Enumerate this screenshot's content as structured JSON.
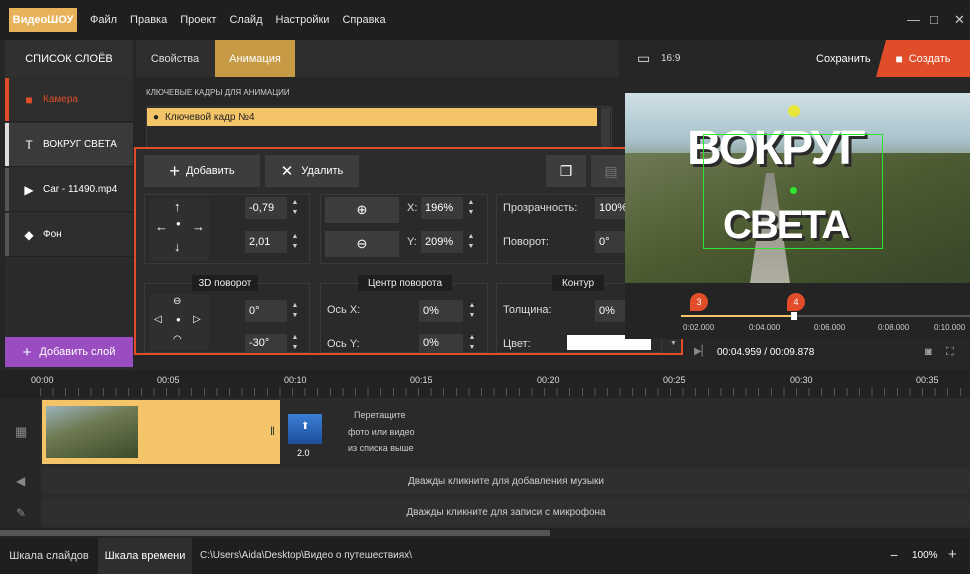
{
  "app": {
    "logo_a": "Видео",
    "logo_b": "ШОУ"
  },
  "menu": [
    "Файл",
    "Правка",
    "Проект",
    "Слайд",
    "Настройки",
    "Справка"
  ],
  "window": {
    "minimize": "—",
    "maximize": "□",
    "close": "✕"
  },
  "layers": {
    "title": "СПИСОК СЛОЁВ",
    "items": [
      {
        "label": "Камера",
        "icon": "camera-icon",
        "glyph": "■"
      },
      {
        "label": "ВОКРУГ  СВЕТА",
        "icon": "text-icon",
        "glyph": "T"
      },
      {
        "label": "Car - 11490.mp4",
        "icon": "video-icon",
        "glyph": "▶"
      },
      {
        "label": "Фон",
        "icon": "fill-icon",
        "glyph": "◆"
      }
    ],
    "add_button": "Добавить слой"
  },
  "tabs": [
    {
      "label": "Свойства"
    },
    {
      "label": "Анимация",
      "active": true
    }
  ],
  "keyframes": {
    "label": "КЛЮЧЕВЫЕ КАДРЫ ДЛЯ АНИМАЦИИ",
    "selected": "Ключевой кадр №4"
  },
  "dialog": {
    "add_button": "Добавить",
    "delete_button": "Удалить",
    "position": {
      "x": "-0,79",
      "y": "2,01"
    },
    "zoom": {
      "x_label": "X:",
      "x_value": "196%",
      "y_label": "Y:",
      "y_value": "209%"
    },
    "opacity_label": "Прозрачность:",
    "opacity_value": "100%",
    "rotation_label": "Поворот:",
    "rotation_value": "0°",
    "rotate3d": {
      "title": "3D поворот",
      "a": "0°",
      "b": "-30°"
    },
    "pivot": {
      "title": "Центр поворота",
      "x_label": "Ось X:",
      "x_value": "0%",
      "y_label": "Ось Y:",
      "y_value": "0%"
    },
    "outline": {
      "title": "Контур",
      "thickness_label": "Толщина:",
      "thickness_value": "0%",
      "color_label": "Цвет:",
      "color": "#ffffff"
    }
  },
  "preview": {
    "aspect": "16:9",
    "save_button": "Сохранить",
    "create_button": "Создать",
    "title_line1": "ВОКРУГ",
    "title_line2": "СВЕТА",
    "markers": [
      "3",
      "4"
    ],
    "ticks": [
      "0:02.000",
      "0:04.000",
      "0:06.000",
      "0:08.000",
      "0:10.000"
    ],
    "time": "00:04.959 / 00:09.878"
  },
  "ruler": [
    "00:00",
    "00:05",
    "00:10",
    "00:15",
    "00:20",
    "00:25",
    "00:30",
    "00:35"
  ],
  "tracks": {
    "transition_duration": "2.0",
    "drop_hint": [
      "Перетащите",
      "фото или видео",
      "из списка выше"
    ],
    "music_hint": "Дважды кликните для добавления музыки",
    "mic_hint": "Дважды кликните для записи с микрофона"
  },
  "status": {
    "tab_slides": "Шкала слайдов",
    "tab_timeline": "Шкала времени",
    "path": "C:\\Users\\Aida\\Desktop\\Видео о путешествиях\\",
    "zoom": "100%"
  },
  "colors": {
    "accent": "#e04d28",
    "active_tab": "#c79b45",
    "keyframe": "#f4c469",
    "add_layer": "#9a4cc1",
    "slide": "#f4c469"
  }
}
